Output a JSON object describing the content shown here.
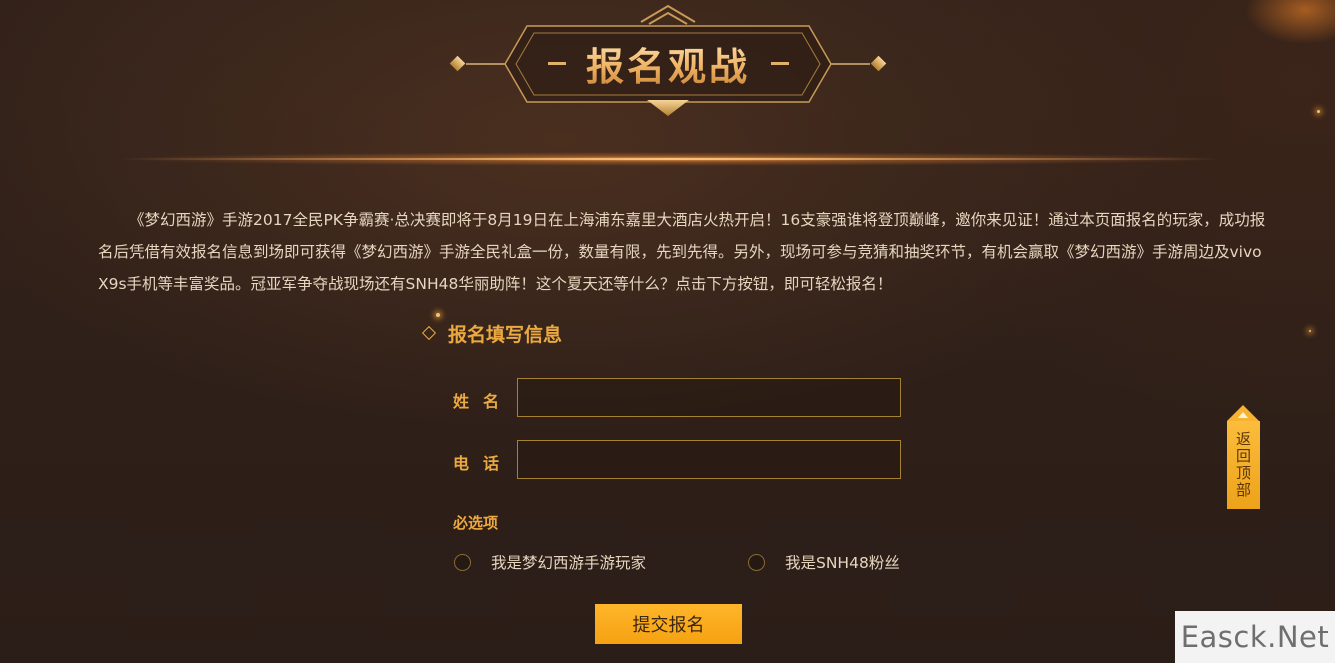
{
  "banner": {
    "title": "报名观战"
  },
  "intro": {
    "text": "《梦幻西游》手游2017全民PK争霸赛·总决赛即将于8月19日在上海浦东嘉里大酒店火热开启！16支豪强谁将登顶巅峰，邀你来见证！通过本页面报名的玩家，成功报名后凭借有效报名信息到场即可获得《梦幻西游》手游全民礼盒一份，数量有限，先到先得。另外，现场可参与竞猜和抽奖环节，有机会赢取《梦幻西游》手游周边及vivo X9s手机等丰富奖品。冠亚军争夺战现场还有SNH48华丽助阵！这个夏天还等什么？点击下方按钮，即可轻松报名！"
  },
  "form": {
    "section_title": "报名填写信息",
    "section_icon": "diamond-icon",
    "name_label": "姓名",
    "name_value": "",
    "phone_label": "电话",
    "phone_value": "",
    "required_label": "必选项",
    "options": [
      {
        "label": "我是梦幻西游手游玩家",
        "selected": false
      },
      {
        "label": "我是SNH48粉丝",
        "selected": false
      }
    ],
    "submit_label": "提交报名"
  },
  "back_to_top": {
    "label": "返回顶部",
    "icon": "arrow-up-icon"
  },
  "watermark": {
    "text": "Easck.Net"
  },
  "colors": {
    "accent": "#eba940",
    "button": "#f5a212",
    "background": "#2f2019",
    "text": "#e6d6bf"
  }
}
